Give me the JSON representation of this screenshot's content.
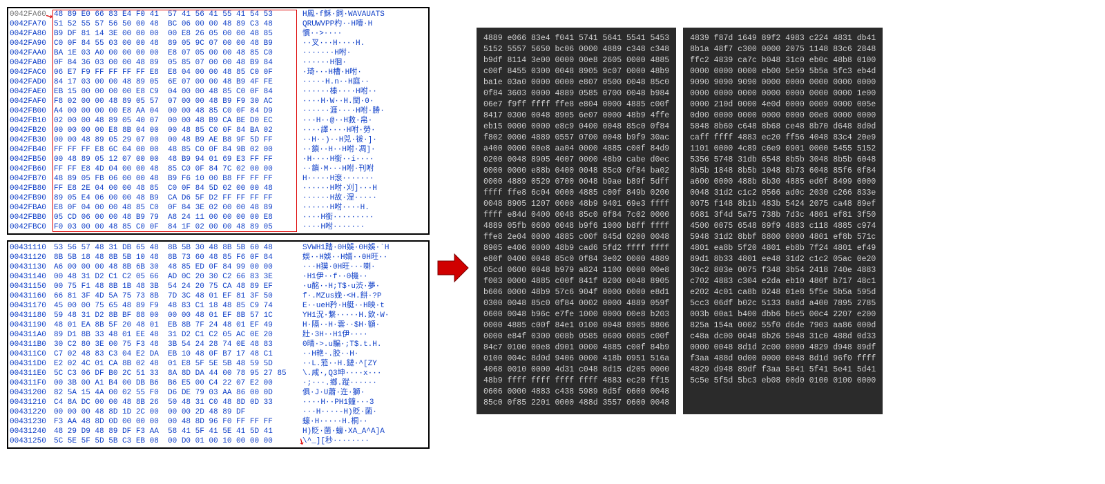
{
  "hex_top": [
    {
      "addr": "0042FA60",
      "b1": "48 89 E0 66 83 E4 F0 41",
      "b2": "57 41 56 41 55 41 54 53",
      "asc": "H鳳·f穌·飼·WAVAUATS"
    },
    {
      "addr": "0042FA70",
      "b1": "51 52 55 57 56 50 00 48",
      "b2": "BC 06 00 00 48 89 C3 48",
      "asc": "QRUWVPP杓··H噎·H"
    },
    {
      "addr": "0042FA80",
      "b1": "B9 DF 81 14 3E 00 00 00",
      "b2": "00 E8 26 05 00 00 48 85",
      "asc": "慣··>····"
    },
    {
      "addr": "0042FA90",
      "b1": "C0 0F 84 55 03 00 00 48",
      "b2": "89 05 9C 07 00 00 48 B9",
      "asc": "··叉···H····H."
    },
    {
      "addr": "0042FAA0",
      "b1": "BA 1E 03 A0 00 00 00 00",
      "b2": "E8 07 05 00 00 48 85 C0",
      "asc": "·······H咐·"
    },
    {
      "addr": "0042FAB0",
      "b1": "0F 84 36 03 00 00 48 89",
      "b2": "05 85 07 00 00 48 B9 84",
      "asc": "······H徊·"
    },
    {
      "addr": "0042FAC0",
      "b1": "06 E7 F9 FF FF FF FF E8",
      "b2": "E8 04 00 00 48 85 C0 0F",
      "asc": "·琦···H槽·H咐·"
    },
    {
      "addr": "0042FAD0",
      "b1": "84 17 03 00 00 48 89 05",
      "b2": "6E 07 00 00 48 B9 4F FE",
      "asc": "·····H.n··H庭··"
    },
    {
      "addr": "0042FAE0",
      "b1": "EB 15 00 00 00 00 E8 C9",
      "b2": "04 00 00 48 85 C0 0F 84",
      "asc": "······榛····H咐··"
    },
    {
      "addr": "0042FAF0",
      "b1": "F8 02 00 00 48 89 05 57",
      "b2": "07 00 00 48 B9 F9 30 AC",
      "asc": "····H·W··H.閏·0·"
    },
    {
      "addr": "0042FB00",
      "b1": "A4 00 00 00 00 E8 AA 04",
      "b2": "00 00 48 85 C0 0F 84 D9",
      "asc": "······涯····H咐·勝·"
    },
    {
      "addr": "0042FB10",
      "b1": "02 00 00 48 89 05 40 07",
      "b2": "00 00 48 B9 CA BE D0 EC",
      "asc": "···H··@··H救·帛·"
    },
    {
      "addr": "0042FB20",
      "b1": "00 00 00 00 E8 8B 04 00",
      "b2": "00 48 85 C0 0F 84 BA 02",
      "asc": "····譯····H咐·勞·"
    },
    {
      "addr": "0042FB30",
      "b1": "00 00 48 89 05 29 07 00",
      "b2": "00 48 B9 AE B8 9F 5D FF",
      "asc": "··H··)··H兕·祓·]·"
    },
    {
      "addr": "0042FB40",
      "b1": "FF FF FF E8 6C 04 00 00",
      "b2": "48 85 C0 0F 84 9B 02 00",
      "asc": "··鎖··H··H咐·凋]·"
    },
    {
      "addr": "0042FB50",
      "b1": "00 48 89 05 12 07 00 00",
      "b2": "48 B9 94 01 69 E3 FF FF",
      "asc": "·H····H銜··i····"
    },
    {
      "addr": "0042FB60",
      "b1": "FF FF E8 4D 04 00 00 48",
      "b2": "85 C0 0F 84 7C 02 00 00",
      "asc": "··鎖·M···H咐·刊咐"
    },
    {
      "addr": "0042FB70",
      "b1": "48 89 05 FB 06 00 00 48",
      "b2": "B9 F6 10 00 B8 FF FF FF",
      "asc": "H·····H滾·······"
    },
    {
      "addr": "0042FB80",
      "b1": "FF E8 2E 04 00 00 48 85",
      "b2": "C0 0F 84 5D 02 00 00 48",
      "asc": "······H咐·刈]···H"
    },
    {
      "addr": "0042FB90",
      "b1": "89 05 E4 06 00 00 48 B9",
      "b2": "CA D6 5F D2 FF FF FF FF",
      "asc": "······H故·涅·····"
    },
    {
      "addr": "0042FBA0",
      "b1": "E8 0F 04 00 00 48 85 C0",
      "b2": "0F 84 3E 02 00 00 48 89",
      "asc": "······H咐····H."
    },
    {
      "addr": "0042FBB0",
      "b1": "05 CD 06 00 00 48 B9 79",
      "b2": "A8 24 11 00 00 00 00 E8",
      "asc": "····H銜·········"
    },
    {
      "addr": "0042FBC0",
      "b1": "F0 03 00 00 48 85 C0 0F",
      "b2": "84 1F 02 00 00 48 89 05",
      "asc": "····H咐·······"
    }
  ],
  "hex_bot": [
    {
      "addr": "00431110",
      "b1": "53 56 57 48 31 DB 65 48",
      "b2": "8B 5B 30 48 8B 5B 60 48",
      "asc": "SVWH1踏·0H娛·0H娛·`H"
    },
    {
      "addr": "00431120",
      "b1": "8B 5B 18 48 8B 5B 10 48",
      "b2": "8B 73 60 48 85 F6 0F 84",
      "asc": "娛··H娛··H婿··0H旺··"
    },
    {
      "addr": "00431130",
      "b1": "A6 00 00 00 48 8B 6B 30",
      "b2": "48 85 ED 0F 84 99 00 00",
      "asc": "···H獏·0H旺···喇·"
    },
    {
      "addr": "00431140",
      "b1": "00 48 31 D2 C1 C2 05 66",
      "b2": "AD 0C 20 30 C2 66 83 3E",
      "asc": "·H1伊··f··0機··"
    },
    {
      "addr": "00431150",
      "b1": "00 75 F1 48 8B 1B 48 3B",
      "b2": "54 24 20 75 CA 48 89 EF",
      "asc": "·u酩··H;T$·u渋·夢·"
    },
    {
      "addr": "00431160",
      "b1": "66 81 3F 4D 5A 75 73 8B",
      "b2": "7D 3C 48 01 EF 81 3F 50",
      "asc": "f·.MZus娩·<H.餅·?P"
    },
    {
      "addr": "00431170",
      "b1": "45 00 00 75 65 48 89 F9",
      "b2": "48 83 C1 18 48 85 C9 74",
      "asc": "E··ueH矜·H艇··H映·t"
    },
    {
      "addr": "00431180",
      "b1": "59 48 31 D2 8B BF 88 00",
      "b2": "00 00 48 01 EF 8B 57 1C",
      "asc": "YH1況·繋·····H.飲·W·"
    },
    {
      "addr": "00431190",
      "b1": "48 01 EA 8B 5F 20 48 01",
      "b2": "EB 8B 7F 24 48 01 EF 49",
      "asc": "H·隔··H·雲··$H·額·"
    },
    {
      "addr": "004311A0",
      "b1": "89 D1 8B 33 48 01 EE 48",
      "b2": "31 D2 C1 C2 05 AC 0E 20",
      "asc": "壯·3H··H1伊····"
    },
    {
      "addr": "004311B0",
      "b1": "30 C2 80 3E 00 75 F3 48",
      "b2": "3B 54 24 28 74 0E 48 83",
      "asc": "0晴·>.u騙·;T$.t.H."
    },
    {
      "addr": "004311C0",
      "b1": "C7 02 48 83 C3 04 E2 DA",
      "b2": "EB 10 48 0F B7 17 48 C1",
      "asc": "··H艳·.胶··H·"
    },
    {
      "addr": "004311D0",
      "b1": "E2 02 4C 01 CA 8B 02 48",
      "b2": "01 E8 5F 5E 5B 48 59 5D",
      "asc": "··L.蒞··H.鏈·^[ZY"
    },
    {
      "addr": "004311E0",
      "b1": "5C C3 06 DF B0 2C 51 33",
      "b2": "8A 8D DA 44 00 78 95 27 85",
      "asc": "\\.咸·,Q3坤····x···"
    },
    {
      "addr": "004311F0",
      "b1": "00 3B 00 A1 B4 00 DB B6",
      "b2": "B6 E5 00 C4 22 07 E2 00",
      "asc": "·;···.鄉.蹤······"
    },
    {
      "addr": "00431200",
      "b1": "82 5A 15 4A 00 02 55 F0",
      "b2": "D6 DE 79 03 AA 86 00 0D",
      "asc": "俱·J·U蕭·迕·獅·"
    },
    {
      "addr": "00431210",
      "b1": "C4 8A DC 00 00 48 8B 26",
      "b2": "50 48 31 C0 48 8D 0D 33",
      "asc": "····H··PH1鐘···3"
    },
    {
      "addr": "00431220",
      "b1": "00 00 00 48 8D 1D 2C 00",
      "b2": "00 00 2D 48 89 DF",
      "asc": "···H····-H)貶·菌·"
    },
    {
      "addr": "00431230",
      "b1": "F3 AA 48 8D 0D 00 00 00",
      "b2": "00 48 8D 96 F0 FF FF FF",
      "asc": "蠔·H·····H.桐··"
    },
    {
      "addr": "00431240",
      "b1": "48 29 D9 48 89 DF F3 AA",
      "b2": "58 41 5F 41 5E 41 5D 41",
      "asc": "H)貶·菌·蠔·XA_A^A]A"
    },
    {
      "addr": "00431250",
      "b1": "5C 5E 5F 5D 5B C3 EB 08",
      "b2": "00 D0 01 00 10 00 00 00",
      "asc": "\\^_][秒········"
    }
  ],
  "dark_left": [
    "4889 e066 83e4 f041 5741 5641 5541 5453",
    "5152 5557 5650 bc06 0000 4889 c348 c348",
    "b9df 8114 3e00 0000 00e8 2605 0000 4885",
    "c00f 8455 0300 0048 8905 9c07 0000 48b9",
    "ba1e 03a0 0000 0000 e807 0500 0048 85c0",
    "0f84 3603 0000 4889 0585 0700 0048 b984",
    "06e7 f9ff ffff ffe8 e804 0000 4885 c00f",
    "8417 0300 0048 8905 6e07 0000 48b9 4ffe",
    "eb15 0000 0000 e8c9 0400 0048 85c0 0f84",
    "f802 0000 4889 0557 0700 0048 b9f9 30ac",
    "a400 0000 00e8 aa04 0000 4885 c00f 84d9",
    "0200 0048 8905 4007 0000 48b9 cabe d0ec",
    "0000 0000 e88b 0400 0048 85c0 0f84 ba02",
    "0000 4889 0529 0700 0048 b9ae b89f 5dff",
    "ffff ffe8 6c04 0000 4885 c00f 849b 0200",
    "0048 8905 1207 0000 48b9 9401 69e3 ffff",
    "ffff e84d 0400 0048 85c0 0f84 7c02 0000",
    "4889 05fb 0600 0048 b9f6 1000 b8ff ffff",
    "ffe8 2e04 0000 4885 c00f 845d 0200 0048",
    "8905 e406 0000 48b9 cad6 5fd2 ffff ffff",
    "e80f 0400 0048 85c0 0f84 3e02 0000 4889",
    "05cd 0600 0048 b979 a824 1100 0000 00e8",
    "f003 0000 4885 c00f 841f 0200 0048 8905",
    "b606 0000 48b9 57c6 904f 0000 0000 e8d1",
    "0300 0048 85c0 0f84 0002 0000 4889 059f",
    "0600 0048 b96c e7fe 1000 0000 00e8 b203",
    "0000 4885 c00f 84e1 0100 0048 8905 8806",
    "0000 e84f 0300 008b 0585 0600 0085 c00f",
    "84c7 0100 00e8 d901 0000 4885 c00f 84b9",
    "0100 004c 8d0d 9406 0000 418b 0951 516a",
    "4068 0010 0000 4d31 c048 8d15 d205 0000",
    "48b9 ffff ffff ffff ffff 4883 ec20 ff15",
    "0606 0000 4883 c438 5989 0d5f 0600 0048",
    "85c0 0f85 2201 0000 488d 3557 0600 0048"
  ],
  "dark_right": [
    "4839 f87d 1649 89f2 4983 c224 4831 db41",
    "8b1a 48f7 c300 0000 2075 1148 83c6 2848",
    "ffc2 4839 ca7c b048 31c0 eb0c 48b8 0100",
    "0000 0000 0000 eb00 5e59 5b5a 5fc3 eb4d",
    "9090 9090 9090 0000 0000 0000 0000 0000",
    "0000 0000 0000 0000 0000 0000 0000 1e00",
    "0000 210d 0000 4e0d 0000 0009 0000 005e",
    "0d00 0000 0000 0000 0000 00e8 0000 0000",
    "5848 8b60 c648 8b68 ce48 8b70 d648 8d0d",
    "caff ffff 4883 ec20 ff56 4048 83c4 20e9",
    "1101 0000 4c89 c6e9 0901 0000 5455 5152",
    "5356 5748 31db 6548 8b5b 3048 8b5b 6048",
    "8b5b 1848 8b5b 1048 8b73 6048 85f6 0f84",
    "a600 0000 488b 6b30 4885 ed0f 8499 0000",
    "0048 31d2 c1c2 0566 ad0c 2030 c266 833e",
    "0075 f148 8b1b 483b 5424 2075 ca48 89ef",
    "6681 3f4d 5a75 738b 7d3c 4801 ef81 3f50",
    "4500 0075 6548 89f9 4883 c118 4885 c974",
    "5948 31d2 8bbf 8800 0000 4801 ef8b 571c",
    "4801 ea8b 5f20 4801 eb8b 7f24 4801 ef49",
    "89d1 8b33 4801 ee48 31d2 c1c2 05ac 0e20",
    "30c2 803e 0075 f348 3b54 2418 740e 4883",
    "c702 4883 c304 e2da eb10 480f b717 48c1",
    "e202 4c01 ca8b 0248 01e8 5f5e 5b5a 595d",
    "5cc3 06df b02c 5133 8a8d a400 7895 2785",
    "003b 00a1 b400 dbb6 b6e5 00c4 2207 e200",
    "825a 154a 0002 55f0 d6de 7903 aa86 000d",
    "c48a dc00 0048 8b26 5048 31c0 488d 0d33",
    "0000 0048 8d1d 2c00 0000 4829 d948 89df",
    "f3aa 488d 0d00 0000 0048 8d1d 96f0 ffff",
    "4829 d948 89df f3aa 5841 5f41 5e41 5d41",
    "5c5e 5f5d 5bc3 eb08 00d0 0100 0100 0000"
  ]
}
